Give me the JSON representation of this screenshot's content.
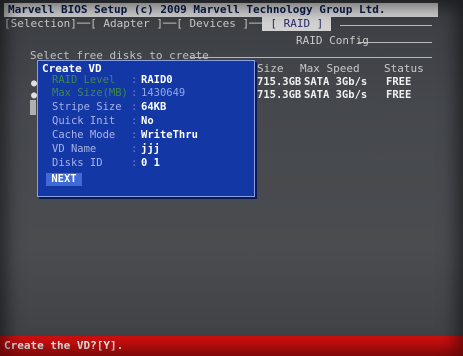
{
  "header": {
    "title": "Marvell BIOS Setup (c) 2009 Marvell Technology Group Ltd."
  },
  "tabs": [
    {
      "label": "[Selection]"
    },
    {
      "label": "[ Adapter ]"
    },
    {
      "label": "[ Devices ]"
    },
    {
      "label": "[ RAID ]"
    }
  ],
  "panel": {
    "title": "RAID Config",
    "instruction": "Select free disks to create"
  },
  "disks": {
    "columns": [
      "Size",
      "Max Speed",
      "Status"
    ],
    "rows": [
      {
        "size": "715.3GB",
        "speed": "SATA 3Gb/s",
        "status": "FREE"
      },
      {
        "size": "715.3GB",
        "speed": "SATA 3Gb/s",
        "status": "FREE"
      }
    ]
  },
  "dialog": {
    "title": "Create VD",
    "fields": [
      {
        "label": "RAID Level",
        "value": "RAID0"
      },
      {
        "label": "Max Size(MB)",
        "value": "1430649"
      },
      {
        "label": "Stripe Size",
        "value": "64KB"
      },
      {
        "label": "Quick Init",
        "value": "No"
      },
      {
        "label": "Cache Mode",
        "value": "WriteThru"
      },
      {
        "label": "VD Name",
        "value": "jjj"
      },
      {
        "label": "Disks ID",
        "value": "0 1"
      }
    ],
    "next_label": "NEXT"
  },
  "status_bar": {
    "text": "Create the VD?[Y]."
  },
  "colors": {
    "dialog_bg": "#1437a6",
    "status_bar": "#d20f0f",
    "title_bar": "#cfcfcf"
  }
}
